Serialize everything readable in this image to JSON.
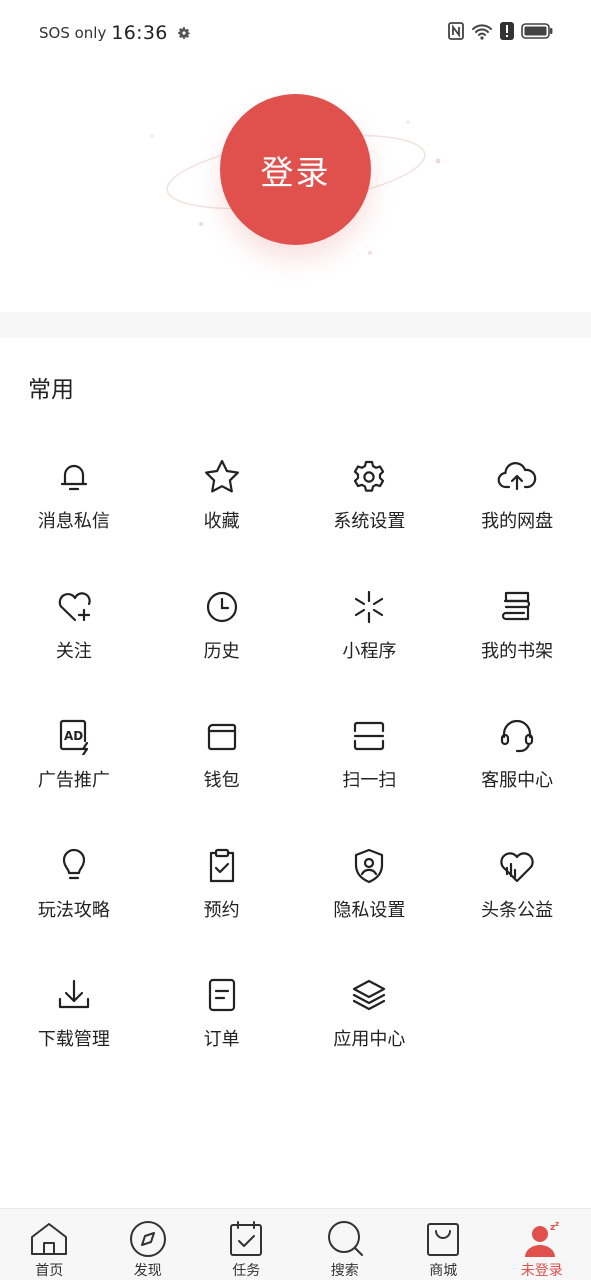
{
  "status_bar": {
    "network": "SOS only",
    "time": "16:36"
  },
  "login": {
    "label": "登录"
  },
  "section": {
    "title": "常用"
  },
  "items": [
    {
      "label": "消息私信",
      "icon": "bell-icon"
    },
    {
      "label": "收藏",
      "icon": "star-icon"
    },
    {
      "label": "系统设置",
      "icon": "gear-icon"
    },
    {
      "label": "我的网盘",
      "icon": "cloud-upload-icon"
    },
    {
      "label": "关注",
      "icon": "heart-plus-icon"
    },
    {
      "label": "历史",
      "icon": "clock-icon"
    },
    {
      "label": "小程序",
      "icon": "mini-program-icon"
    },
    {
      "label": "我的书架",
      "icon": "bookshelf-icon"
    },
    {
      "label": "广告推广",
      "icon": "ad-icon"
    },
    {
      "label": "钱包",
      "icon": "wallet-icon"
    },
    {
      "label": "扫一扫",
      "icon": "scan-icon"
    },
    {
      "label": "客服中心",
      "icon": "headset-icon"
    },
    {
      "label": "玩法攻略",
      "icon": "lightbulb-icon"
    },
    {
      "label": "预约",
      "icon": "clipboard-check-icon"
    },
    {
      "label": "隐私设置",
      "icon": "shield-user-icon"
    },
    {
      "label": "头条公益",
      "icon": "charity-heart-icon"
    },
    {
      "label": "下载管理",
      "icon": "download-icon"
    },
    {
      "label": "订单",
      "icon": "order-icon"
    },
    {
      "label": "应用中心",
      "icon": "layers-icon"
    }
  ],
  "tabs": [
    {
      "label": "首页",
      "icon": "home-icon"
    },
    {
      "label": "发现",
      "icon": "compass-icon"
    },
    {
      "label": "任务",
      "icon": "calendar-check-icon"
    },
    {
      "label": "搜索",
      "icon": "search-icon"
    },
    {
      "label": "商城",
      "icon": "shopping-bag-icon"
    },
    {
      "label": "未登录",
      "icon": "user-sleep-icon"
    }
  ],
  "colors": {
    "accent": "#e0514d",
    "text": "#222222",
    "tabbar_bg": "#f7f7f7"
  }
}
